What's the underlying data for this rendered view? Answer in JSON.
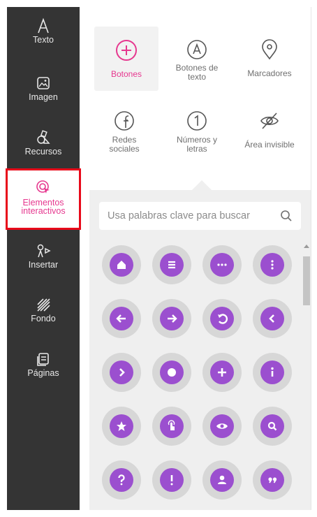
{
  "sidebar": {
    "items": [
      {
        "label": "Texto",
        "icon": "text-icon"
      },
      {
        "label": "Imagen",
        "icon": "image-icon"
      },
      {
        "label": "Recursos",
        "icon": "resources-icon"
      },
      {
        "label": "Elementos interactivos",
        "icon": "interactive-icon",
        "active": true
      },
      {
        "label": "Insertar",
        "icon": "insert-icon"
      },
      {
        "label": "Fondo",
        "icon": "background-icon"
      },
      {
        "label": "Páginas",
        "icon": "pages-icon"
      }
    ]
  },
  "topnav": {
    "items": [
      {
        "label": "Botones",
        "icon": "plus-circle-icon",
        "active": true
      },
      {
        "label": "Botones de texto",
        "icon": "letter-a-circle-icon"
      },
      {
        "label": "Marcadores",
        "icon": "map-pin-icon"
      },
      {
        "label": "Redes sociales",
        "icon": "facebook-circle-icon"
      },
      {
        "label": "Números y letras",
        "icon": "number-one-circle-icon"
      },
      {
        "label": "Área invisible",
        "icon": "eye-off-icon"
      }
    ]
  },
  "search": {
    "placeholder": "Usa palabras clave para buscar",
    "value": ""
  },
  "button_grid": {
    "icons": [
      "home-icon",
      "menu-icon",
      "more-horizontal-icon",
      "more-vertical-icon",
      "arrow-left-icon",
      "arrow-right-icon",
      "undo-icon",
      "chevron-left-icon",
      "chevron-right-icon",
      "dot-icon",
      "plus-icon",
      "info-icon",
      "star-icon",
      "tap-icon",
      "eye-icon",
      "search-icon",
      "question-icon",
      "exclamation-icon",
      "user-icon",
      "quote-icon"
    ]
  },
  "colors": {
    "sidebar_bg": "#343434",
    "accent": "#e6388f",
    "button_purple": "#9b4fcf",
    "button_halo": "#d7d7d7",
    "panel_bg": "#efefef",
    "highlight_border": "#e8091a"
  }
}
